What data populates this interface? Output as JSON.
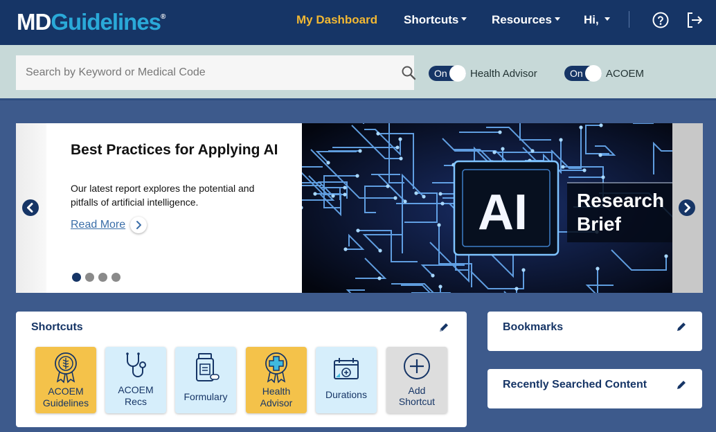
{
  "header": {
    "logo": {
      "md": "MD",
      "guidelines": "Guidelines",
      "reg": "®"
    },
    "nav": {
      "dashboard": "My Dashboard",
      "shortcuts": "Shortcuts",
      "resources": "Resources",
      "greeting": "Hi,"
    }
  },
  "search": {
    "placeholder": "Search by Keyword or Medical Code",
    "toggles": [
      {
        "state": "On",
        "label": "Health Advisor"
      },
      {
        "state": "On",
        "label": "ACOEM"
      }
    ]
  },
  "carousel": {
    "title": "Best Practices for Applying AI",
    "description": "Our latest report explores the potential and pitfalls of artificial intelligence.",
    "read_more": "Read More",
    "image_text": {
      "ai": "AI",
      "line1": "Research",
      "line2": "Brief"
    },
    "dot_count": 4,
    "active_dot": 1
  },
  "shortcuts": {
    "title": "Shortcuts",
    "items": [
      {
        "label_line1": "ACOEM",
        "label_line2": "Guidelines",
        "color": "yellow"
      },
      {
        "label_line1": "ACOEM",
        "label_line2": "Recs",
        "color": "blue"
      },
      {
        "label_line1": "Formulary",
        "label_line2": "",
        "color": "blue"
      },
      {
        "label_line1": "Health",
        "label_line2": "Advisor",
        "color": "yellow"
      },
      {
        "label_line1": "Durations",
        "label_line2": "",
        "color": "blue"
      },
      {
        "label_line1": "Add",
        "label_line2": "Shortcut",
        "color": "gray"
      }
    ]
  },
  "bookmarks": {
    "title": "Bookmarks"
  },
  "recent": {
    "title": "Recently Searched Content"
  },
  "colors": {
    "header_bg": "#163566",
    "accent_yellow": "#f2b833",
    "page_bg": "#3d5a8c",
    "search_band_bg": "#c7d9d8"
  }
}
